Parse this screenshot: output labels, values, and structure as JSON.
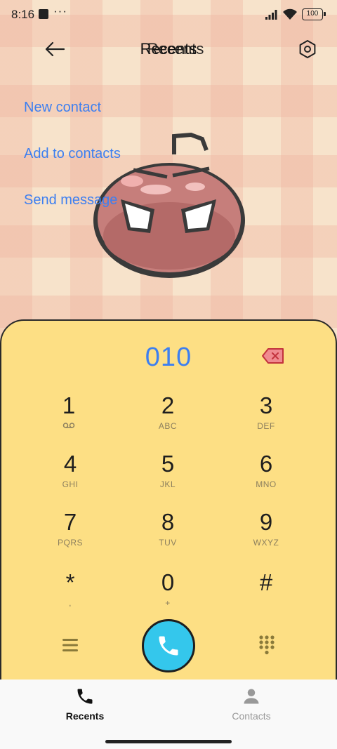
{
  "status_bar": {
    "time": "8:16",
    "more": "···",
    "battery": "100"
  },
  "header": {
    "title": "Recents",
    "title_overlap": "Recents",
    "back_icon": "back-arrow-icon",
    "settings_icon": "settings-hexagon-icon"
  },
  "actions": [
    {
      "label": "New contact"
    },
    {
      "label": "Add to contacts"
    },
    {
      "label": "Send message"
    }
  ],
  "dialpad": {
    "number": "010",
    "colors": {
      "panel": "#fddf84",
      "accent": "#3d7ff0",
      "call": "#34c7ec",
      "backspace": "#e8505b"
    },
    "keys": [
      {
        "digit": "1",
        "sub": ""
      },
      {
        "digit": "2",
        "sub": "ABC"
      },
      {
        "digit": "3",
        "sub": "DEF"
      },
      {
        "digit": "4",
        "sub": "GHI"
      },
      {
        "digit": "5",
        "sub": "JKL"
      },
      {
        "digit": "6",
        "sub": "MNO"
      },
      {
        "digit": "7",
        "sub": "PQRS"
      },
      {
        "digit": "8",
        "sub": "TUV"
      },
      {
        "digit": "9",
        "sub": "WXYZ"
      },
      {
        "digit": "*",
        "sub": ","
      },
      {
        "digit": "0",
        "sub": "+"
      },
      {
        "digit": "#",
        "sub": ""
      }
    ]
  },
  "bottom_nav": {
    "tabs": [
      {
        "label": "Recents",
        "icon": "phone-icon",
        "active": true
      },
      {
        "label": "Contacts",
        "icon": "person-icon",
        "active": false
      }
    ]
  }
}
